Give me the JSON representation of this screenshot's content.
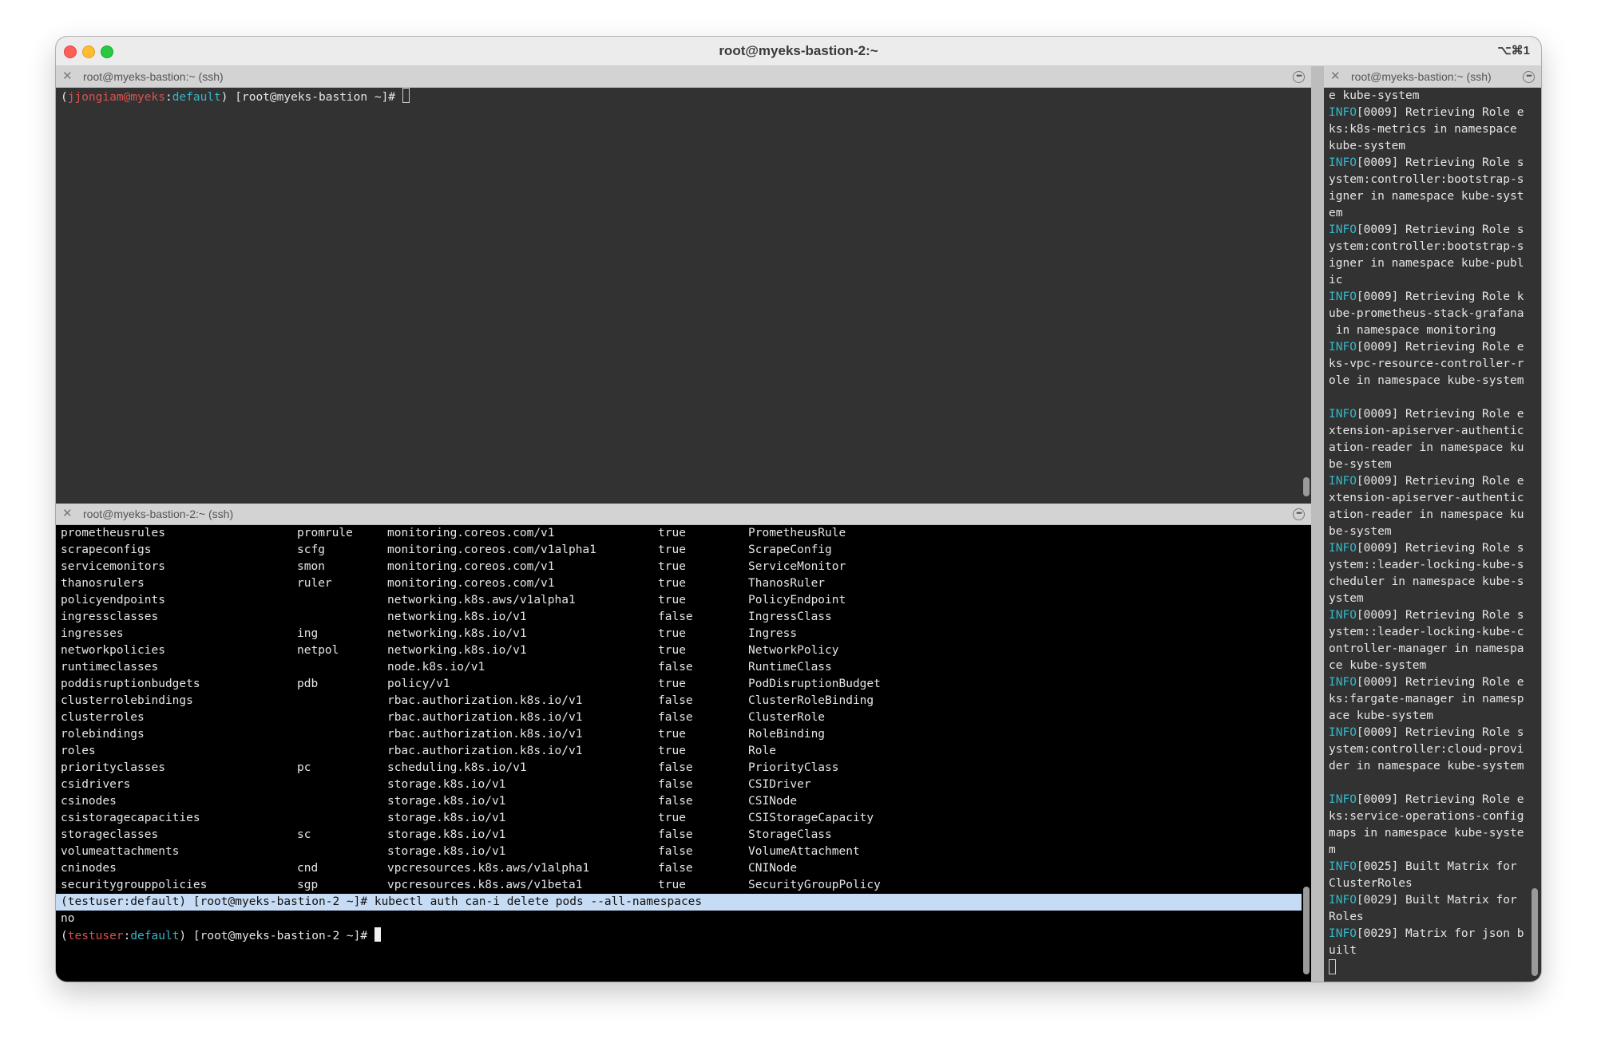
{
  "window": {
    "title": "root@myeks-bastion-2:~",
    "shortcut": "⌥⌘1"
  },
  "colors": {
    "prompt_user": "#d9534f",
    "prompt_context": "#35b8c9",
    "info": "#35b8c9",
    "selection": "#c6dcf5"
  },
  "pane_top_left": {
    "tab_title": "root@myeks-bastion:~ (ssh)",
    "prompt": {
      "open": "(",
      "user": "jjongiam@myeks",
      "sep": ":",
      "context": "default",
      "rest": ") [root@myeks-bastion ~]# "
    }
  },
  "pane_bottom_left": {
    "tab_title": "root@myeks-bastion-2:~ (ssh)",
    "resources": [
      [
        "prometheusrules",
        "promrule",
        "monitoring.coreos.com/v1",
        "true",
        "PrometheusRule"
      ],
      [
        "scrapeconfigs",
        "scfg",
        "monitoring.coreos.com/v1alpha1",
        "true",
        "ScrapeConfig"
      ],
      [
        "servicemonitors",
        "smon",
        "monitoring.coreos.com/v1",
        "true",
        "ServiceMonitor"
      ],
      [
        "thanosrulers",
        "ruler",
        "monitoring.coreos.com/v1",
        "true",
        "ThanosRuler"
      ],
      [
        "policyendpoints",
        "",
        "networking.k8s.aws/v1alpha1",
        "true",
        "PolicyEndpoint"
      ],
      [
        "ingressclasses",
        "",
        "networking.k8s.io/v1",
        "false",
        "IngressClass"
      ],
      [
        "ingresses",
        "ing",
        "networking.k8s.io/v1",
        "true",
        "Ingress"
      ],
      [
        "networkpolicies",
        "netpol",
        "networking.k8s.io/v1",
        "true",
        "NetworkPolicy"
      ],
      [
        "runtimeclasses",
        "",
        "node.k8s.io/v1",
        "false",
        "RuntimeClass"
      ],
      [
        "poddisruptionbudgets",
        "pdb",
        "policy/v1",
        "true",
        "PodDisruptionBudget"
      ],
      [
        "clusterrolebindings",
        "",
        "rbac.authorization.k8s.io/v1",
        "false",
        "ClusterRoleBinding"
      ],
      [
        "clusterroles",
        "",
        "rbac.authorization.k8s.io/v1",
        "false",
        "ClusterRole"
      ],
      [
        "rolebindings",
        "",
        "rbac.authorization.k8s.io/v1",
        "true",
        "RoleBinding"
      ],
      [
        "roles",
        "",
        "rbac.authorization.k8s.io/v1",
        "true",
        "Role"
      ],
      [
        "priorityclasses",
        "pc",
        "scheduling.k8s.io/v1",
        "false",
        "PriorityClass"
      ],
      [
        "csidrivers",
        "",
        "storage.k8s.io/v1",
        "false",
        "CSIDriver"
      ],
      [
        "csinodes",
        "",
        "storage.k8s.io/v1",
        "false",
        "CSINode"
      ],
      [
        "csistoragecapacities",
        "",
        "storage.k8s.io/v1",
        "true",
        "CSIStorageCapacity"
      ],
      [
        "storageclasses",
        "sc",
        "storage.k8s.io/v1",
        "false",
        "StorageClass"
      ],
      [
        "volumeattachments",
        "",
        "storage.k8s.io/v1",
        "false",
        "VolumeAttachment"
      ],
      [
        "cninodes",
        "cnd",
        "vpcresources.k8s.aws/v1alpha1",
        "false",
        "CNINode"
      ],
      [
        "securitygrouppolicies",
        "sgp",
        "vpcresources.k8s.aws/v1beta1",
        "true",
        "SecurityGroupPolicy"
      ]
    ],
    "command_line": "(testuser:default) [root@myeks-bastion-2 ~]# kubectl auth can-i delete pods --all-namespaces",
    "output": "no",
    "prompt": {
      "open": "(",
      "user": "testuser",
      "sep": ":",
      "context": "default",
      "rest": ") [root@myeks-bastion-2 ~]# "
    }
  },
  "pane_right": {
    "tab_title": "root@myeks-bastion:~ (ssh)",
    "lines": [
      {
        "info": "",
        "text": "e kube-system"
      },
      {
        "info": "INFO",
        "text": "[0009] Retrieving Role e"
      },
      {
        "info": "",
        "text": "ks:k8s-metrics in namespace"
      },
      {
        "info": "",
        "text": "kube-system"
      },
      {
        "info": "INFO",
        "text": "[0009] Retrieving Role s"
      },
      {
        "info": "",
        "text": "ystem:controller:bootstrap-s"
      },
      {
        "info": "",
        "text": "igner in namespace kube-syst"
      },
      {
        "info": "",
        "text": "em"
      },
      {
        "info": "INFO",
        "text": "[0009] Retrieving Role s"
      },
      {
        "info": "",
        "text": "ystem:controller:bootstrap-s"
      },
      {
        "info": "",
        "text": "igner in namespace kube-publ"
      },
      {
        "info": "",
        "text": "ic"
      },
      {
        "info": "INFO",
        "text": "[0009] Retrieving Role k"
      },
      {
        "info": "",
        "text": "ube-prometheus-stack-grafana"
      },
      {
        "info": "",
        "text": " in namespace monitoring"
      },
      {
        "info": "INFO",
        "text": "[0009] Retrieving Role e"
      },
      {
        "info": "",
        "text": "ks-vpc-resource-controller-r"
      },
      {
        "info": "",
        "text": "ole in namespace kube-system"
      },
      {
        "info": "",
        "text": ""
      },
      {
        "info": "INFO",
        "text": "[0009] Retrieving Role e"
      },
      {
        "info": "",
        "text": "xtension-apiserver-authentic"
      },
      {
        "info": "",
        "text": "ation-reader in namespace ku"
      },
      {
        "info": "",
        "text": "be-system"
      },
      {
        "info": "INFO",
        "text": "[0009] Retrieving Role e"
      },
      {
        "info": "",
        "text": "xtension-apiserver-authentic"
      },
      {
        "info": "",
        "text": "ation-reader in namespace ku"
      },
      {
        "info": "",
        "text": "be-system"
      },
      {
        "info": "INFO",
        "text": "[0009] Retrieving Role s"
      },
      {
        "info": "",
        "text": "ystem::leader-locking-kube-s"
      },
      {
        "info": "",
        "text": "cheduler in namespace kube-s"
      },
      {
        "info": "",
        "text": "ystem"
      },
      {
        "info": "INFO",
        "text": "[0009] Retrieving Role s"
      },
      {
        "info": "",
        "text": "ystem::leader-locking-kube-c"
      },
      {
        "info": "",
        "text": "ontroller-manager in namespa"
      },
      {
        "info": "",
        "text": "ce kube-system"
      },
      {
        "info": "INFO",
        "text": "[0009] Retrieving Role e"
      },
      {
        "info": "",
        "text": "ks:fargate-manager in namesp"
      },
      {
        "info": "",
        "text": "ace kube-system"
      },
      {
        "info": "INFO",
        "text": "[0009] Retrieving Role s"
      },
      {
        "info": "",
        "text": "ystem:controller:cloud-provi"
      },
      {
        "info": "",
        "text": "der in namespace kube-system"
      },
      {
        "info": "",
        "text": ""
      },
      {
        "info": "INFO",
        "text": "[0009] Retrieving Role e"
      },
      {
        "info": "",
        "text": "ks:service-operations-config"
      },
      {
        "info": "",
        "text": "maps in namespace kube-syste"
      },
      {
        "info": "",
        "text": "m"
      },
      {
        "info": "INFO",
        "text": "[0025] Built Matrix for"
      },
      {
        "info": "",
        "text": "ClusterRoles"
      },
      {
        "info": "INFO",
        "text": "[0029] Built Matrix for"
      },
      {
        "info": "",
        "text": "Roles"
      },
      {
        "info": "INFO",
        "text": "[0029] Matrix for json b"
      },
      {
        "info": "",
        "text": "uilt"
      }
    ]
  }
}
